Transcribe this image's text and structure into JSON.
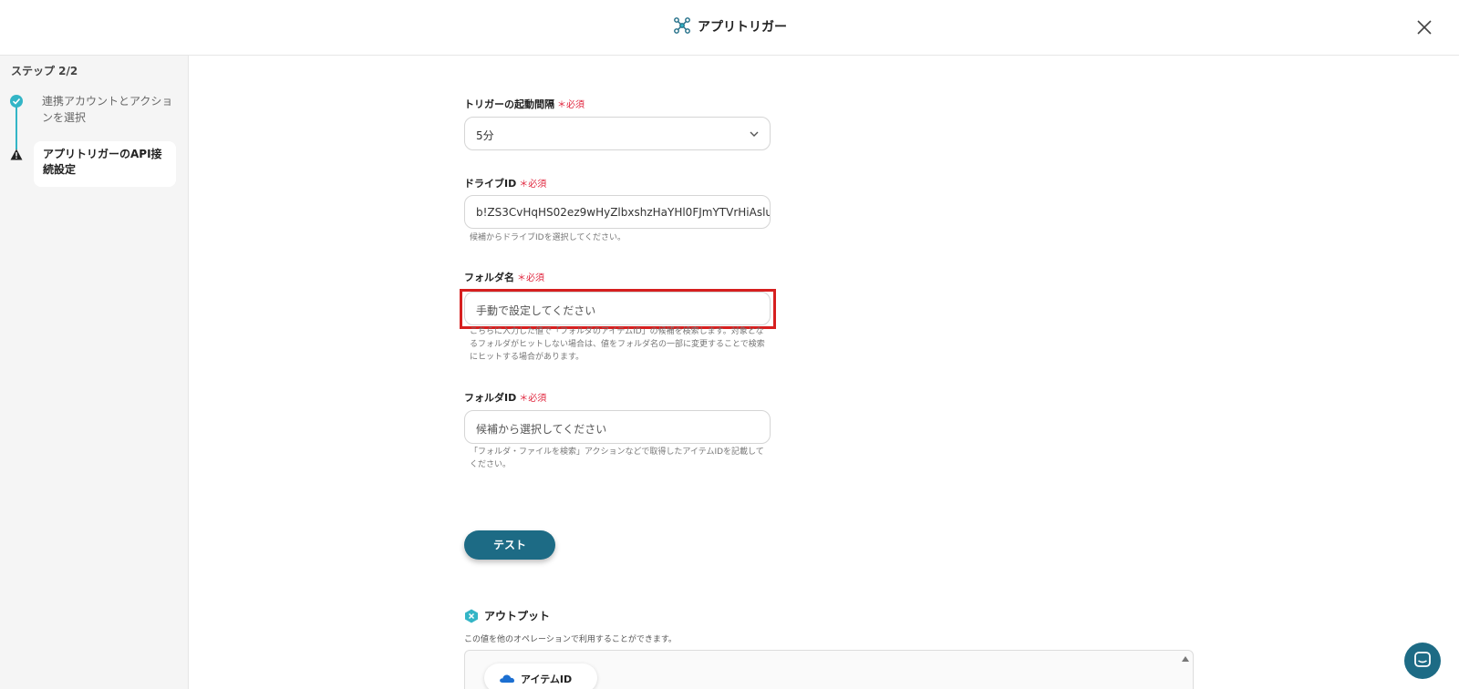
{
  "header": {
    "title": "アプリトリガー"
  },
  "sidebar": {
    "step_count": "ステップ 2/2",
    "steps": [
      {
        "label": "連携アカウントとアクションを選択",
        "status": "done"
      },
      {
        "label": "アプリトリガーのAPI接続設定",
        "status": "warning"
      }
    ]
  },
  "form": {
    "required_mark": "＊必須",
    "interval": {
      "label": "トリガーの起動間隔",
      "value": "5分"
    },
    "drive_id": {
      "label": "ドライブID",
      "value": "b!ZS3CvHqHS02ez9wHyZlbxshzHaYHl0FJmYTVrHiAslu",
      "hint": "候補からドライブIDを選択してください。"
    },
    "folder_name": {
      "label": "フォルダ名",
      "placeholder": "手動で設定してください",
      "hint": "こちらに入力した値で「フォルダのアイテムID」の候補を検索します。対象となるフォルダがヒットしない場合は、値をフォルダ名の一部に変更することで検索にヒットする場合があります。"
    },
    "folder_id": {
      "label": "フォルダID",
      "placeholder": "候補から選択してください",
      "hint": "「フォルダ・ファイルを検索」アクションなどで取得したアイテムIDを記載してください。"
    }
  },
  "test_button": "テスト",
  "output": {
    "title": "アウトプット",
    "description": "この値を他のオペレーションで利用することができます。",
    "items": [
      {
        "label": "アイテムID"
      }
    ]
  },
  "colors": {
    "accent": "#1d6b85",
    "step": "#33b5c6",
    "required": "#e0243c",
    "highlight": "#d61f1f"
  }
}
